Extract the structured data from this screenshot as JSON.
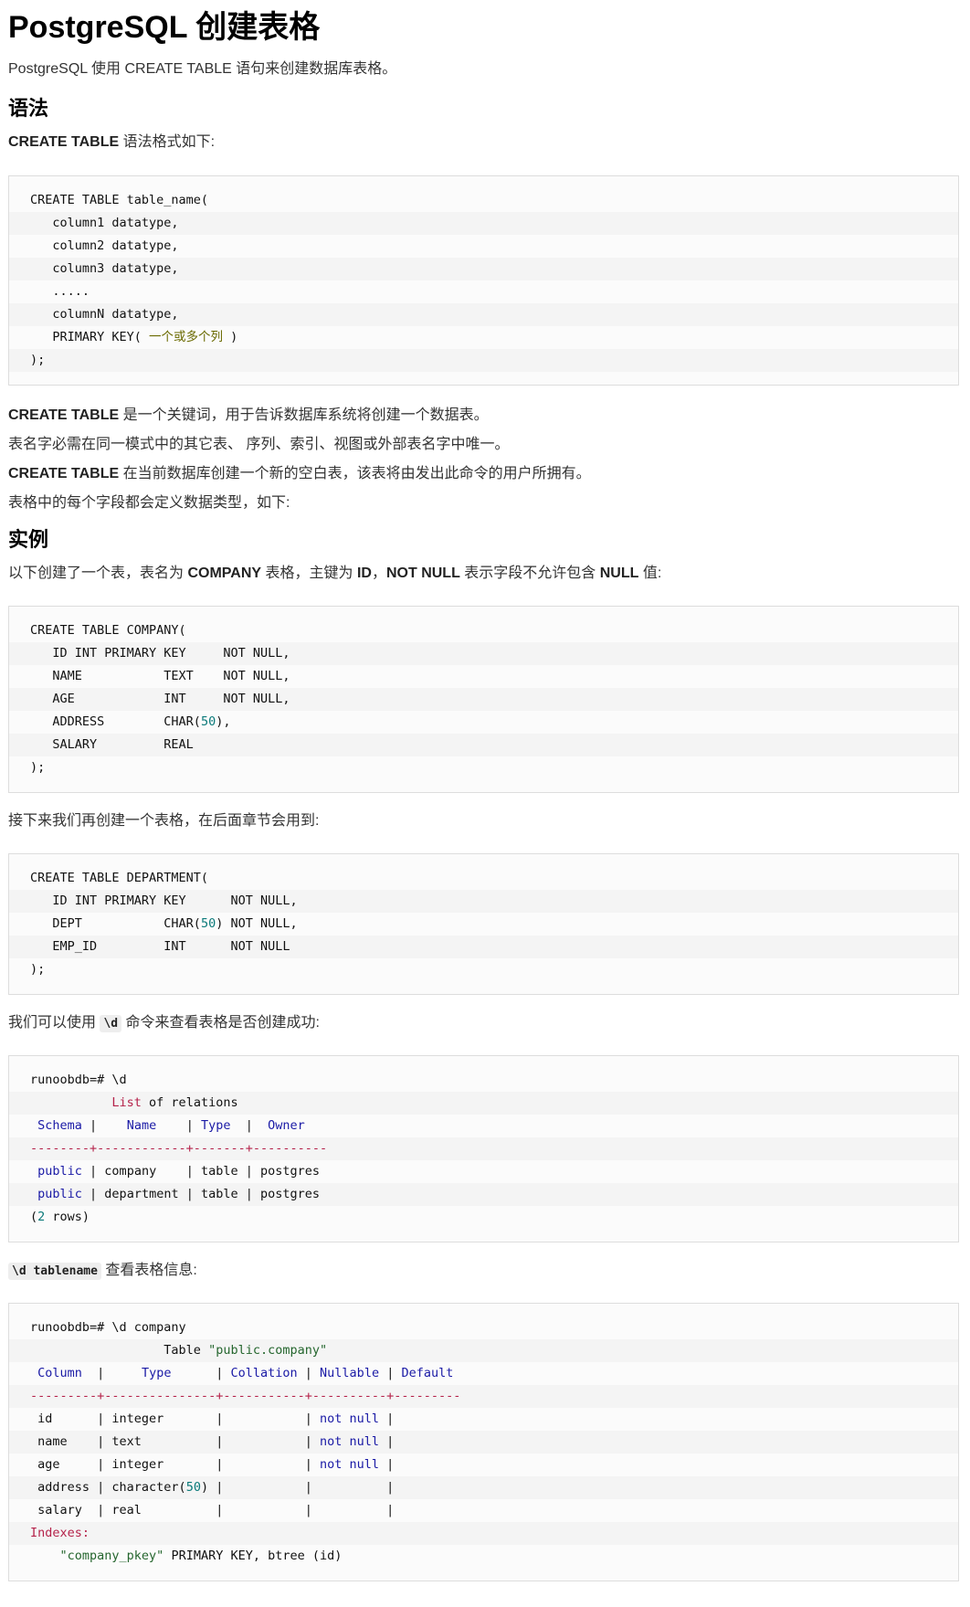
{
  "title": "PostgreSQL 创建表格",
  "intro": "PostgreSQL 使用 CREATE TABLE 语句来创建数据库表格。",
  "syntax": {
    "heading": "语法",
    "lead_bold": "CREATE TABLE",
    "lead_rest": " 语法格式如下:",
    "code": [
      "CREATE TABLE table_name(",
      "   column1 datatype,",
      "   column2 datatype,",
      "   column3 datatype,",
      "   .....",
      "   columnN datatype,",
      "   PRIMARY KEY( 一个或多个列 )",
      ");"
    ]
  },
  "notes": [
    {
      "bold": "CREATE TABLE",
      "rest": " 是一个关键词，用于告诉数据库系统将创建一个数据表。"
    },
    {
      "bold": "",
      "rest": "表名字必需在同一模式中的其它表、 序列、索引、视图或外部表名字中唯一。"
    },
    {
      "bold": "CREATE TABLE",
      "rest": " 在当前数据库创建一个新的空白表，该表将由发出此命令的用户所拥有。"
    },
    {
      "bold": "",
      "rest": "表格中的每个字段都会定义数据类型，如下:"
    }
  ],
  "example": {
    "heading": "实例",
    "lead_parts": [
      "以下创建了一个表，表名为 ",
      "COMPANY",
      " 表格，主键为 ",
      "ID",
      "，",
      "NOT NULL",
      " 表示字段不允许包含 ",
      "NULL",
      " 值:"
    ],
    "code": [
      "CREATE TABLE COMPANY(",
      "   ID INT PRIMARY KEY     NOT NULL,",
      "   NAME           TEXT    NOT NULL,",
      "   AGE            INT     NOT NULL,",
      "   ADDRESS        CHAR(50),",
      "   SALARY         REAL",
      ");"
    ]
  },
  "department": {
    "lead": "接下来我们再创建一个表格，在后面章节会用到:",
    "code": [
      "CREATE TABLE DEPARTMENT(",
      "   ID INT PRIMARY KEY      NOT NULL,",
      "   DEPT           CHAR(50) NOT NULL,",
      "   EMP_ID         INT      NOT NULL",
      ");"
    ]
  },
  "check": {
    "lead_pre": "我们可以使用 ",
    "lead_code": "\\d",
    "lead_post": " 命令来查看表格是否创建成功:",
    "code": [
      "runoobdb=# \\d",
      "           List of relations",
      " Schema |    Name    | Type  |  Owner",
      "--------+------------+-------+----------",
      " public | company    | table | postgres",
      " public | department | table | postgres",
      "(2 rows)"
    ]
  },
  "describe": {
    "lead_code": "\\d tablename",
    "lead_post": " 查看表格信息:",
    "code": [
      "runoobdb=# \\d company",
      "                  Table \"public.company\"",
      " Column  |     Type      | Collation | Nullable | Default",
      "---------+---------------+-----------+----------+---------",
      " id      | integer       |           | not null |",
      " name    | text          |           | not null |",
      " age     | integer       |           | not null |",
      " address | character(50) |           |          |",
      " salary  | real          |           |          |",
      "Indexes:",
      "    \"company_pkey\" PRIMARY KEY, btree (id)"
    ]
  }
}
